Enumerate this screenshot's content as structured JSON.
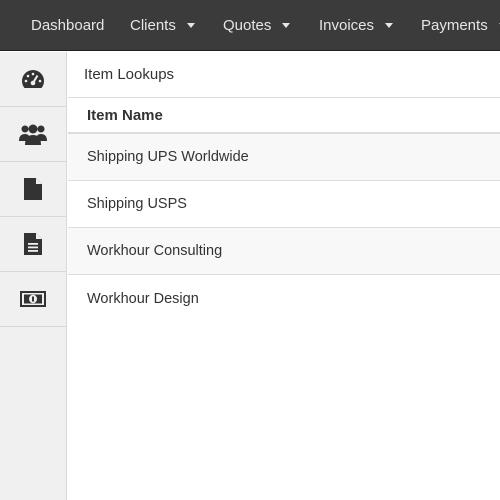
{
  "nav": {
    "dashboard": "Dashboard",
    "clients": "Clients",
    "quotes": "Quotes",
    "invoices": "Invoices",
    "payments": "Payments"
  },
  "sidebar": {
    "items": [
      {
        "icon": "dashboard-gauge-icon"
      },
      {
        "icon": "users-icon"
      },
      {
        "icon": "file-icon"
      },
      {
        "icon": "file-text-icon"
      },
      {
        "icon": "money-icon"
      }
    ]
  },
  "panel": {
    "title": "Item Lookups"
  },
  "table": {
    "columns": [
      "Item Name"
    ],
    "rows": [
      "Shipping UPS Worldwide",
      "Shipping USPS",
      "Workhour Consulting",
      "Workhour Design"
    ]
  },
  "colors": {
    "navbar_bg": "#3b3b3b",
    "sidebar_bg": "#f0f0f0",
    "icon": "#333333"
  }
}
